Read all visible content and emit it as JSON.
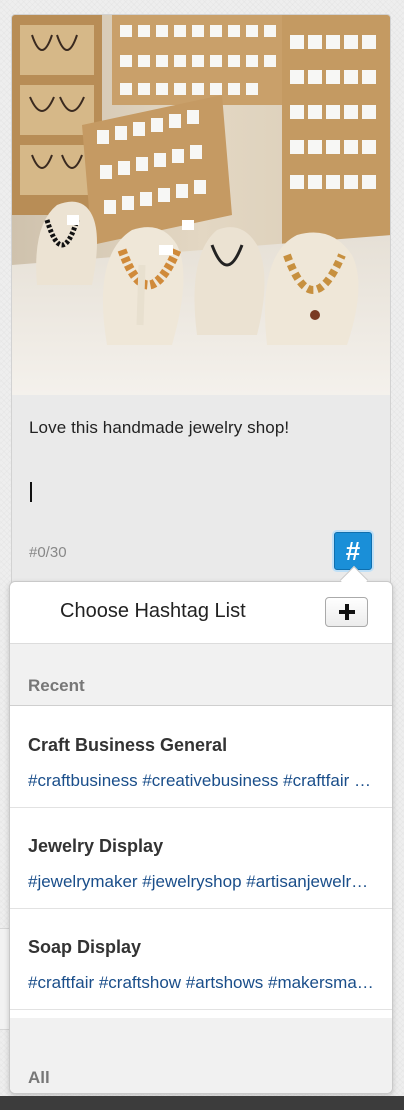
{
  "post": {
    "image_description": "handmade jewelry shop display",
    "caption": "Love this handmade jewelry shop!",
    "hashtag_counter": "#0/30",
    "hashtag_button_label": "#"
  },
  "hashtag_popover": {
    "title": "Choose Hashtag List",
    "add_icon": "plus-icon",
    "recent_header": "Recent",
    "all_header": "All",
    "lists": [
      {
        "name": "Craft Business General",
        "tags": "#craftbusiness #creativebusiness #craftfair #handmadebusiness"
      },
      {
        "name": "Jewelry Display",
        "tags": "#jewelrymaker #jewelryshop #artisanjewelry #handmadejewelry"
      },
      {
        "name": "Soap Display",
        "tags": "#craftfair #craftshow #artshows #makersmarket"
      }
    ]
  },
  "colors": {
    "accent": "#1a8fd8",
    "tag_link": "#1a4e8a"
  }
}
